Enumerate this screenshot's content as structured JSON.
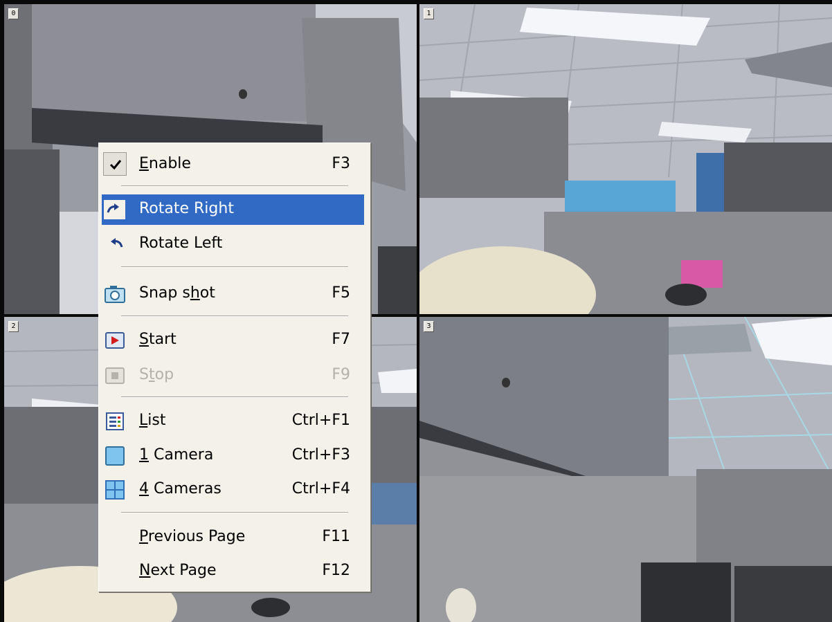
{
  "cameras": [
    {
      "number": "0"
    },
    {
      "number": "1"
    },
    {
      "number": "2"
    },
    {
      "number": "3"
    }
  ],
  "menu": {
    "items": [
      {
        "label": "Enable",
        "mnemonic": "E",
        "shortcut": "F3",
        "checked": true,
        "icon": "check-icon"
      },
      {
        "label": "Rotate Right",
        "shortcut": "",
        "highlighted": true,
        "icon": "rotate-right-icon"
      },
      {
        "label": "Rotate Left",
        "shortcut": "",
        "icon": "rotate-left-icon"
      },
      {
        "label": "Snap shot",
        "mnemonic": "h",
        "shortcut": "F5",
        "icon": "camera-icon"
      },
      {
        "label": "Start",
        "mnemonic": "S",
        "shortcut": "F7",
        "icon": "play-icon"
      },
      {
        "label": "Stop",
        "mnemonic": "t",
        "shortcut": "F9",
        "disabled": true,
        "icon": "stop-icon"
      },
      {
        "label": "List",
        "mnemonic": "L",
        "shortcut": "Ctrl+F1",
        "icon": "list-icon"
      },
      {
        "label": "1 Camera",
        "mnemonic": "1",
        "shortcut": "Ctrl+F3",
        "icon": "single-view-icon"
      },
      {
        "label": "4 Cameras",
        "mnemonic": "4",
        "shortcut": "Ctrl+F4",
        "icon": "quad-view-icon"
      },
      {
        "label": "Previous Page",
        "mnemonic": "P",
        "shortcut": "F11"
      },
      {
        "label": "Next Page",
        "mnemonic": "N",
        "shortcut": "F12"
      }
    ]
  },
  "colors": {
    "highlight": "#316ac5",
    "menu_background": "#f4f2e8",
    "disabled_text": "#b3b1a8"
  }
}
